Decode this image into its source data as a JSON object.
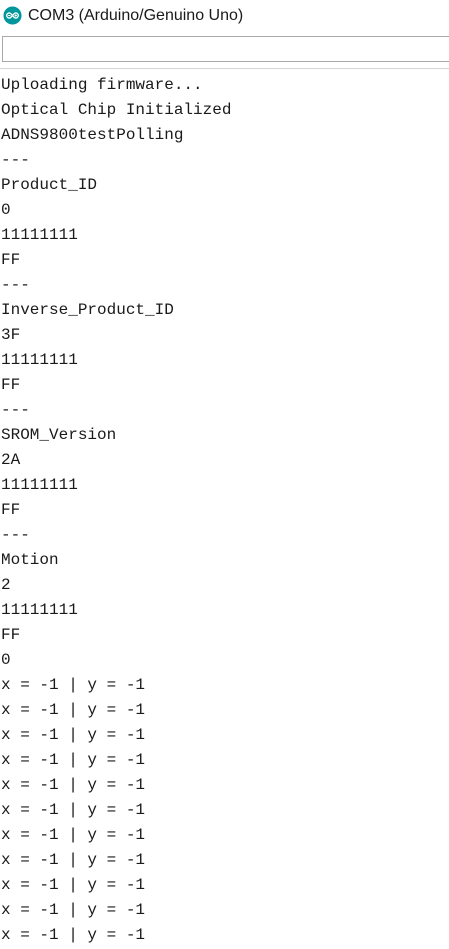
{
  "window": {
    "title": "COM3 (Arduino/Genuino Uno)",
    "icon": "arduino-logo-icon",
    "icon_color": "#00979c"
  },
  "send_input": {
    "value": ""
  },
  "serial_output": {
    "lines": [
      "Uploading firmware...",
      "Optical Chip Initialized",
      "ADNS9800testPolling",
      "---",
      "Product_ID",
      "0",
      "11111111",
      "FF",
      "---",
      "Inverse_Product_ID",
      "3F",
      "11111111",
      "FF",
      "---",
      "SROM_Version",
      "2A",
      "11111111",
      "FF",
      "---",
      "Motion",
      "2",
      "11111111",
      "FF",
      "0",
      "x = -1 | y = -1",
      "x = -1 | y = -1",
      "x = -1 | y = -1",
      "x = -1 | y = -1",
      "x = -1 | y = -1",
      "x = -1 | y = -1",
      "x = -1 | y = -1",
      "x = -1 | y = -1",
      "x = -1 | y = -1",
      "x = -1 | y = -1",
      "x = -1 | y = -1"
    ]
  }
}
